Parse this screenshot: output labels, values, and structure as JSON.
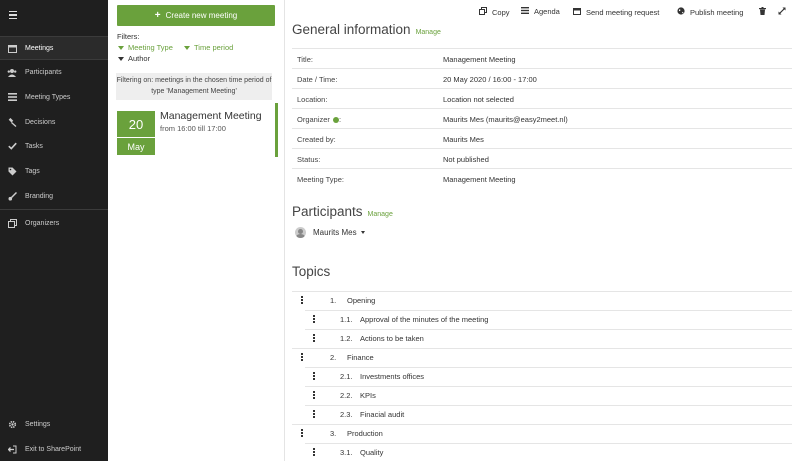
{
  "sidebar": {
    "items": [
      {
        "label": "Meetings",
        "icon": "calendar-icon"
      },
      {
        "label": "Participants",
        "icon": "users-icon"
      },
      {
        "label": "Meeting Types",
        "icon": "list-icon"
      },
      {
        "label": "Decisions",
        "icon": "gavel-icon"
      },
      {
        "label": "Tasks",
        "icon": "check-icon"
      },
      {
        "label": "Tags",
        "icon": "tags-icon"
      },
      {
        "label": "Branding",
        "icon": "brush-icon"
      },
      {
        "label": "Organizers",
        "icon": "clone-icon"
      }
    ],
    "bottom": [
      {
        "label": "Settings",
        "icon": "gear-icon"
      },
      {
        "label": "Exit to SharePoint",
        "icon": "exit-icon"
      }
    ]
  },
  "list": {
    "create_label": "Create new meeting",
    "filters_label": "Filters:",
    "filter_meeting_type": "Meeting Type",
    "filter_time_period": "Time period",
    "filter_author": "Author",
    "filter_note": "Filtering on: meetings in the chosen time period of type 'Management Meeting'",
    "meeting": {
      "day": "20",
      "month": "May",
      "title": "Management Meeting",
      "time": "from 16:00 till 17:00"
    }
  },
  "toolbar": {
    "copy": "Copy",
    "agenda": "Agenda",
    "send_request": "Send meeting request",
    "publish": "Publish meeting"
  },
  "general": {
    "title": "General information",
    "manage": "Manage",
    "rows": [
      {
        "k": "Title:",
        "v": "Management Meeting"
      },
      {
        "k": "Date / Time:",
        "v": "20 May 2020 / 16:00 - 17:00"
      },
      {
        "k": "Location:",
        "v": "Location not selected"
      },
      {
        "k": "Organizer",
        "v": "Maurits Mes (maurits@easy2meet.nl)"
      },
      {
        "k": "Created by:",
        "v": "Maurits Mes"
      },
      {
        "k": "Status:",
        "v": "Not published"
      },
      {
        "k": "Meeting Type:",
        "v": "Management Meeting"
      }
    ],
    "organizer_colon": ":"
  },
  "participants": {
    "title": "Participants",
    "manage": "Manage",
    "person": "Maurits Mes"
  },
  "topics": {
    "title": "Topics",
    "items": [
      {
        "num": "1.",
        "text": "Opening",
        "level": 0
      },
      {
        "num": "1.1.",
        "text": "Approval of the minutes of the meeting",
        "level": 1
      },
      {
        "num": "1.2.",
        "text": "Actions to be taken",
        "level": 1
      },
      {
        "num": "2.",
        "text": "Finance",
        "level": 0
      },
      {
        "num": "2.1.",
        "text": "Investments offices",
        "level": 1
      },
      {
        "num": "2.2.",
        "text": "KPIs",
        "level": 1
      },
      {
        "num": "2.3.",
        "text": "Finacial audit",
        "level": 1
      },
      {
        "num": "3.",
        "text": "Production",
        "level": 0
      },
      {
        "num": "3.1.",
        "text": "Quality",
        "level": 1
      }
    ]
  },
  "colors": {
    "accent": "#6aa13c",
    "sidebar": "#1f1f1f"
  }
}
